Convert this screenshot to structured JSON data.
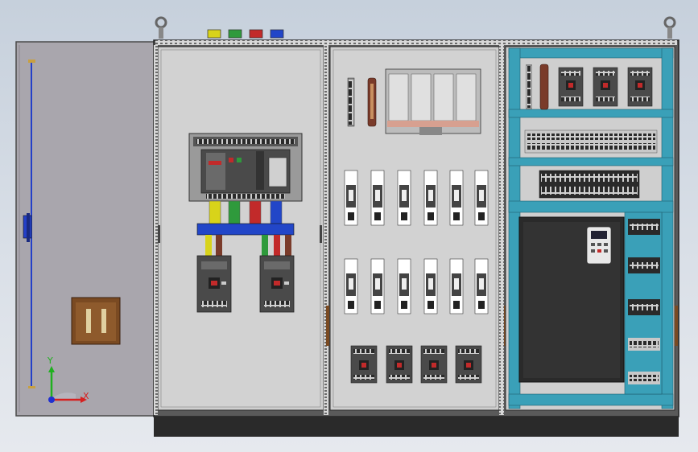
{
  "viewport": {
    "background_top": "#c6d0dc",
    "background_bottom": "#e6e9ee"
  },
  "colors": {
    "door_panel": "#a9a6ad",
    "cabinet_frame": "#3c3c3c",
    "mounting_plate": "#cfcfcf",
    "teal_duct": "#3aa0b8",
    "busbar_yellow": "#d8d31a",
    "busbar_green": "#2f9a3c",
    "busbar_red": "#c22a2a",
    "busbar_blue": "#2246c8",
    "busbar_brown": "#7a3b2a",
    "breaker_body": "#4a4a4a",
    "plinth": "#2a2a2a"
  },
  "phase_tags": [
    "yellow",
    "green",
    "red",
    "blue"
  ],
  "icons": {
    "lifting_eye": "ring-icon",
    "door_handle": "handle-icon",
    "door_lock": "lock-box-icon",
    "axis_triad": "xyz-triad-icon"
  },
  "triad": {
    "x_label": "X",
    "y_label": "Y",
    "x_color": "#d62020",
    "y_color": "#20b020",
    "z_color": "#2030d0"
  },
  "counts": {
    "fuse_row_1": 6,
    "fuse_row_2": 6,
    "mccb_small": 4,
    "mini_breakers": 3,
    "side_modules": 5
  }
}
